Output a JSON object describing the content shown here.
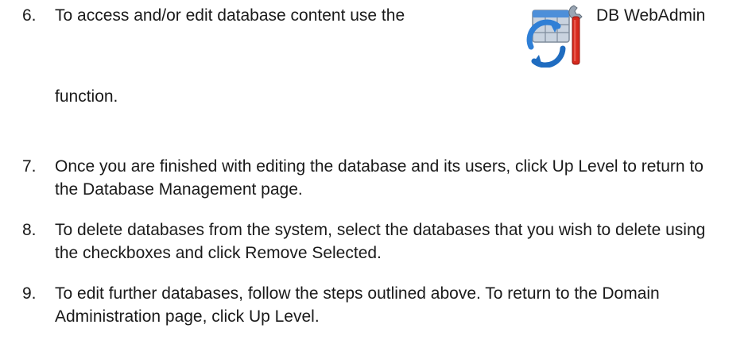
{
  "steps": [
    {
      "number": "6.",
      "text_before_icon": "To access and/or edit database content use the",
      "icon": "db-webadmin-icon",
      "text_after_icon": "DB WebAdmin",
      "text_continued": "function."
    },
    {
      "number": "7.",
      "text": "Once you are finished with editing the database and its users, click Up Level to return to the Database Management page."
    },
    {
      "number": "8.",
      "text": "To delete databases from the system, select the databases that you wish to delete using the checkboxes and click Remove Selected."
    },
    {
      "number": "9.",
      "text": "To edit further databases, follow the steps outlined above. To return to the Domain Administration page, click Up Level."
    }
  ],
  "colors": {
    "text": "#1a1a1a",
    "icon_blue": "#2f7fd6",
    "icon_red": "#d62a1e",
    "icon_gray": "#9aa6b4"
  }
}
